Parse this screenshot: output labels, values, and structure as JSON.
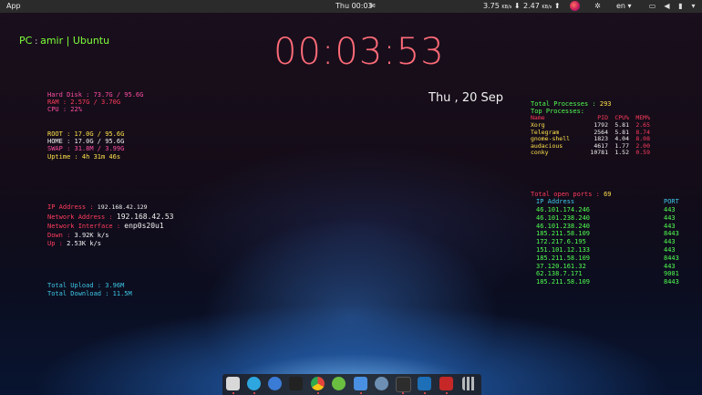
{
  "topbar": {
    "app": "App",
    "clock": "Thu 00:03",
    "net_down_val": "3.75",
    "net_down_unit": "KB/s",
    "net_up_val": "2.47",
    "net_up_unit": "KB/s",
    "lang": "en"
  },
  "pc": {
    "label": "PC",
    "sep": " : ",
    "name": "amir | Ubuntu"
  },
  "clock": "00:03:53",
  "date": "Thu , 20  Sep",
  "system": {
    "hdd": "Hard Disk  :  73.7G / 95.6G",
    "ram": "RAM  :  2.57G / 3.70G",
    "cpu": "CPU  :  22%"
  },
  "disk": {
    "root": "ROOT  :  17.0G / 95.6G",
    "home": "HOME  :  17.0G / 95.6G",
    "swap": "SWAP  :  31.8M / 3.99G",
    "uptime": "Uptime  :  4h 31m 46s"
  },
  "network": {
    "ip_label": "IP Address  :",
    "ip_value": "192.168.42.129",
    "netaddr_label": "Network Address  :",
    "netaddr_value": "192.168.42.53",
    "iface_label": "Network Interface  :",
    "iface_value": "enp0s20u1",
    "down_label": "Down  :",
    "down_value": "3.92K k/s",
    "up_label": "Up  :",
    "up_value": "2.53K k/s"
  },
  "totals": {
    "upload": "Total Upload  :  3.96M",
    "download": "Total Download  :  11.5M"
  },
  "processes": {
    "total_label": "Total Processes  :",
    "total_value": "293",
    "top_label": "Top Processes:",
    "headers": [
      "Name",
      "PID",
      "CPU%",
      "MEM%"
    ],
    "rows": [
      [
        "Xorg",
        "1792",
        "5.81",
        "2.65"
      ],
      [
        "Telegram",
        "2564",
        "5.81",
        "8.74"
      ],
      [
        "gnome-shell",
        "1823",
        "4.04",
        "8.08"
      ],
      [
        "audacious",
        "4617",
        "1.77",
        "2.00"
      ],
      [
        "conky",
        "10781",
        "1.52",
        "0.59"
      ]
    ]
  },
  "ports": {
    "label": "Total open ports  :",
    "count": "69",
    "headers": [
      "IP Address",
      "PORT"
    ],
    "rows": [
      [
        "46.101.174.246",
        "443"
      ],
      [
        "46.101.238.240",
        "443"
      ],
      [
        "46.101.238.240",
        "443"
      ],
      [
        "185.211.58.109",
        "8443"
      ],
      [
        "172.217.6.195",
        "443"
      ],
      [
        "151.101.12.133",
        "443"
      ],
      [
        "185.211.58.109",
        "8443"
      ],
      [
        "37.120.161.32",
        "443"
      ],
      [
        "62.138.7.171",
        "9001"
      ],
      [
        "185.211.58.109",
        "8443"
      ]
    ]
  },
  "dock": {
    "apps": [
      {
        "name": "files",
        "color": "#d8d8d8"
      },
      {
        "name": "telegram",
        "color": "#2ea6df"
      },
      {
        "name": "settings",
        "color": "#3a7bd5"
      },
      {
        "name": "inkscape",
        "color": "#222222"
      },
      {
        "name": "chrome",
        "color": "#e2453c"
      },
      {
        "name": "globe",
        "color": "#6abf40"
      },
      {
        "name": "bluetooth",
        "color": "#4a90e2"
      },
      {
        "name": "disks",
        "color": "#6d8fb3"
      },
      {
        "name": "terminal",
        "color": "#2d2d2d"
      },
      {
        "name": "vscode",
        "color": "#1d6fb8"
      },
      {
        "name": "dictionary",
        "color": "#c62828"
      },
      {
        "name": "app-grid",
        "color": "#444444"
      }
    ]
  }
}
